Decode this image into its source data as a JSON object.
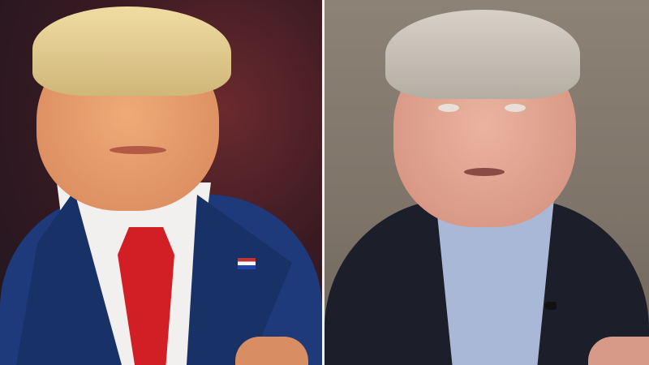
{
  "colors": {
    "left_background": "#3a1a22",
    "left_suit": "#1f3a7a",
    "left_shirt": "#f2f0ee",
    "left_tie": "#d21f25",
    "left_skin": "#e59a68",
    "left_hair": "#e0c98c",
    "right_background": "#857a6f",
    "right_suit": "#1c1f2a",
    "right_shirt": "#a9b8d6",
    "right_skin": "#e3a996",
    "right_hair": "#c9c4ba",
    "divider": "#f4f4f4"
  }
}
